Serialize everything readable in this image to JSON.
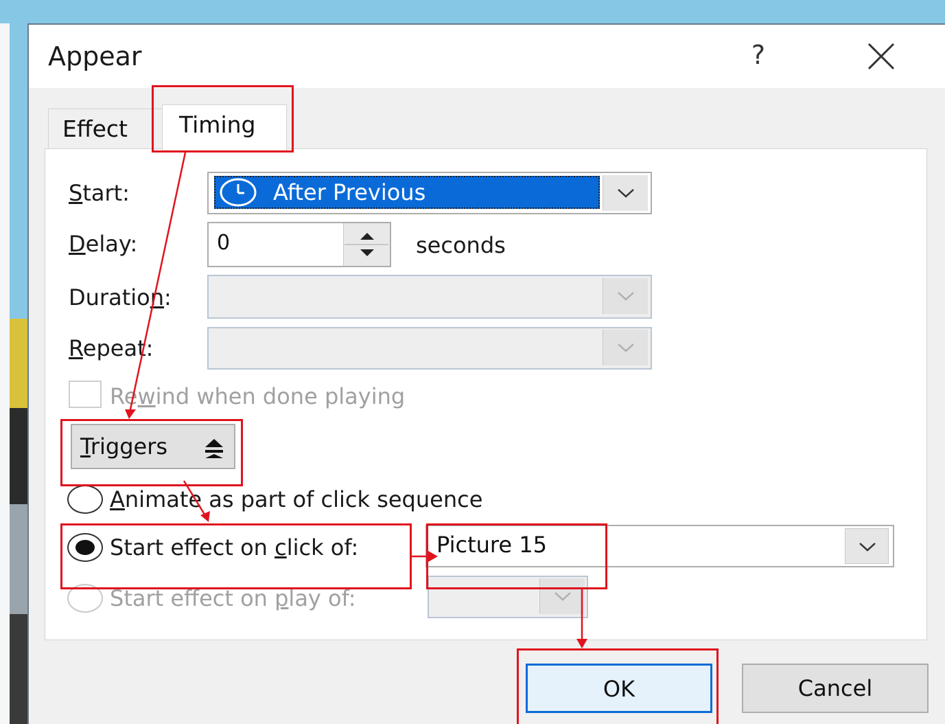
{
  "dialog": {
    "title": "Appear",
    "help_glyph": "?",
    "close_icon": "close-icon"
  },
  "tabs": [
    {
      "label": "Effect",
      "active": false
    },
    {
      "label": "Timing",
      "active": true
    }
  ],
  "timing": {
    "start_label": "Start:",
    "start_value": "After Previous",
    "start_icon": "clock-icon",
    "delay_label": "Delay:",
    "delay_value": "0",
    "delay_unit": "seconds",
    "duration_label": "Duration:",
    "duration_value": "",
    "repeat_label": "Repeat:",
    "repeat_value": "",
    "rewind_label": "Rewind when done playing",
    "rewind_checked": false
  },
  "triggers": {
    "button_label": "Triggers",
    "button_icon": "collapse-up-icon",
    "options": [
      {
        "label": "Animate as part of click sequence",
        "selected": false,
        "enabled": true
      },
      {
        "label": "Start effect on click of:",
        "selected": true,
        "enabled": true
      },
      {
        "label": "Start effect on play of:",
        "selected": false,
        "enabled": false
      }
    ],
    "click_of_value": "Picture 15",
    "play_of_value": ""
  },
  "buttons": {
    "ok_label": "OK",
    "cancel_label": "Cancel"
  },
  "colors": {
    "annotation_red": "#e0141e",
    "selection_blue": "#0a6bd8"
  }
}
